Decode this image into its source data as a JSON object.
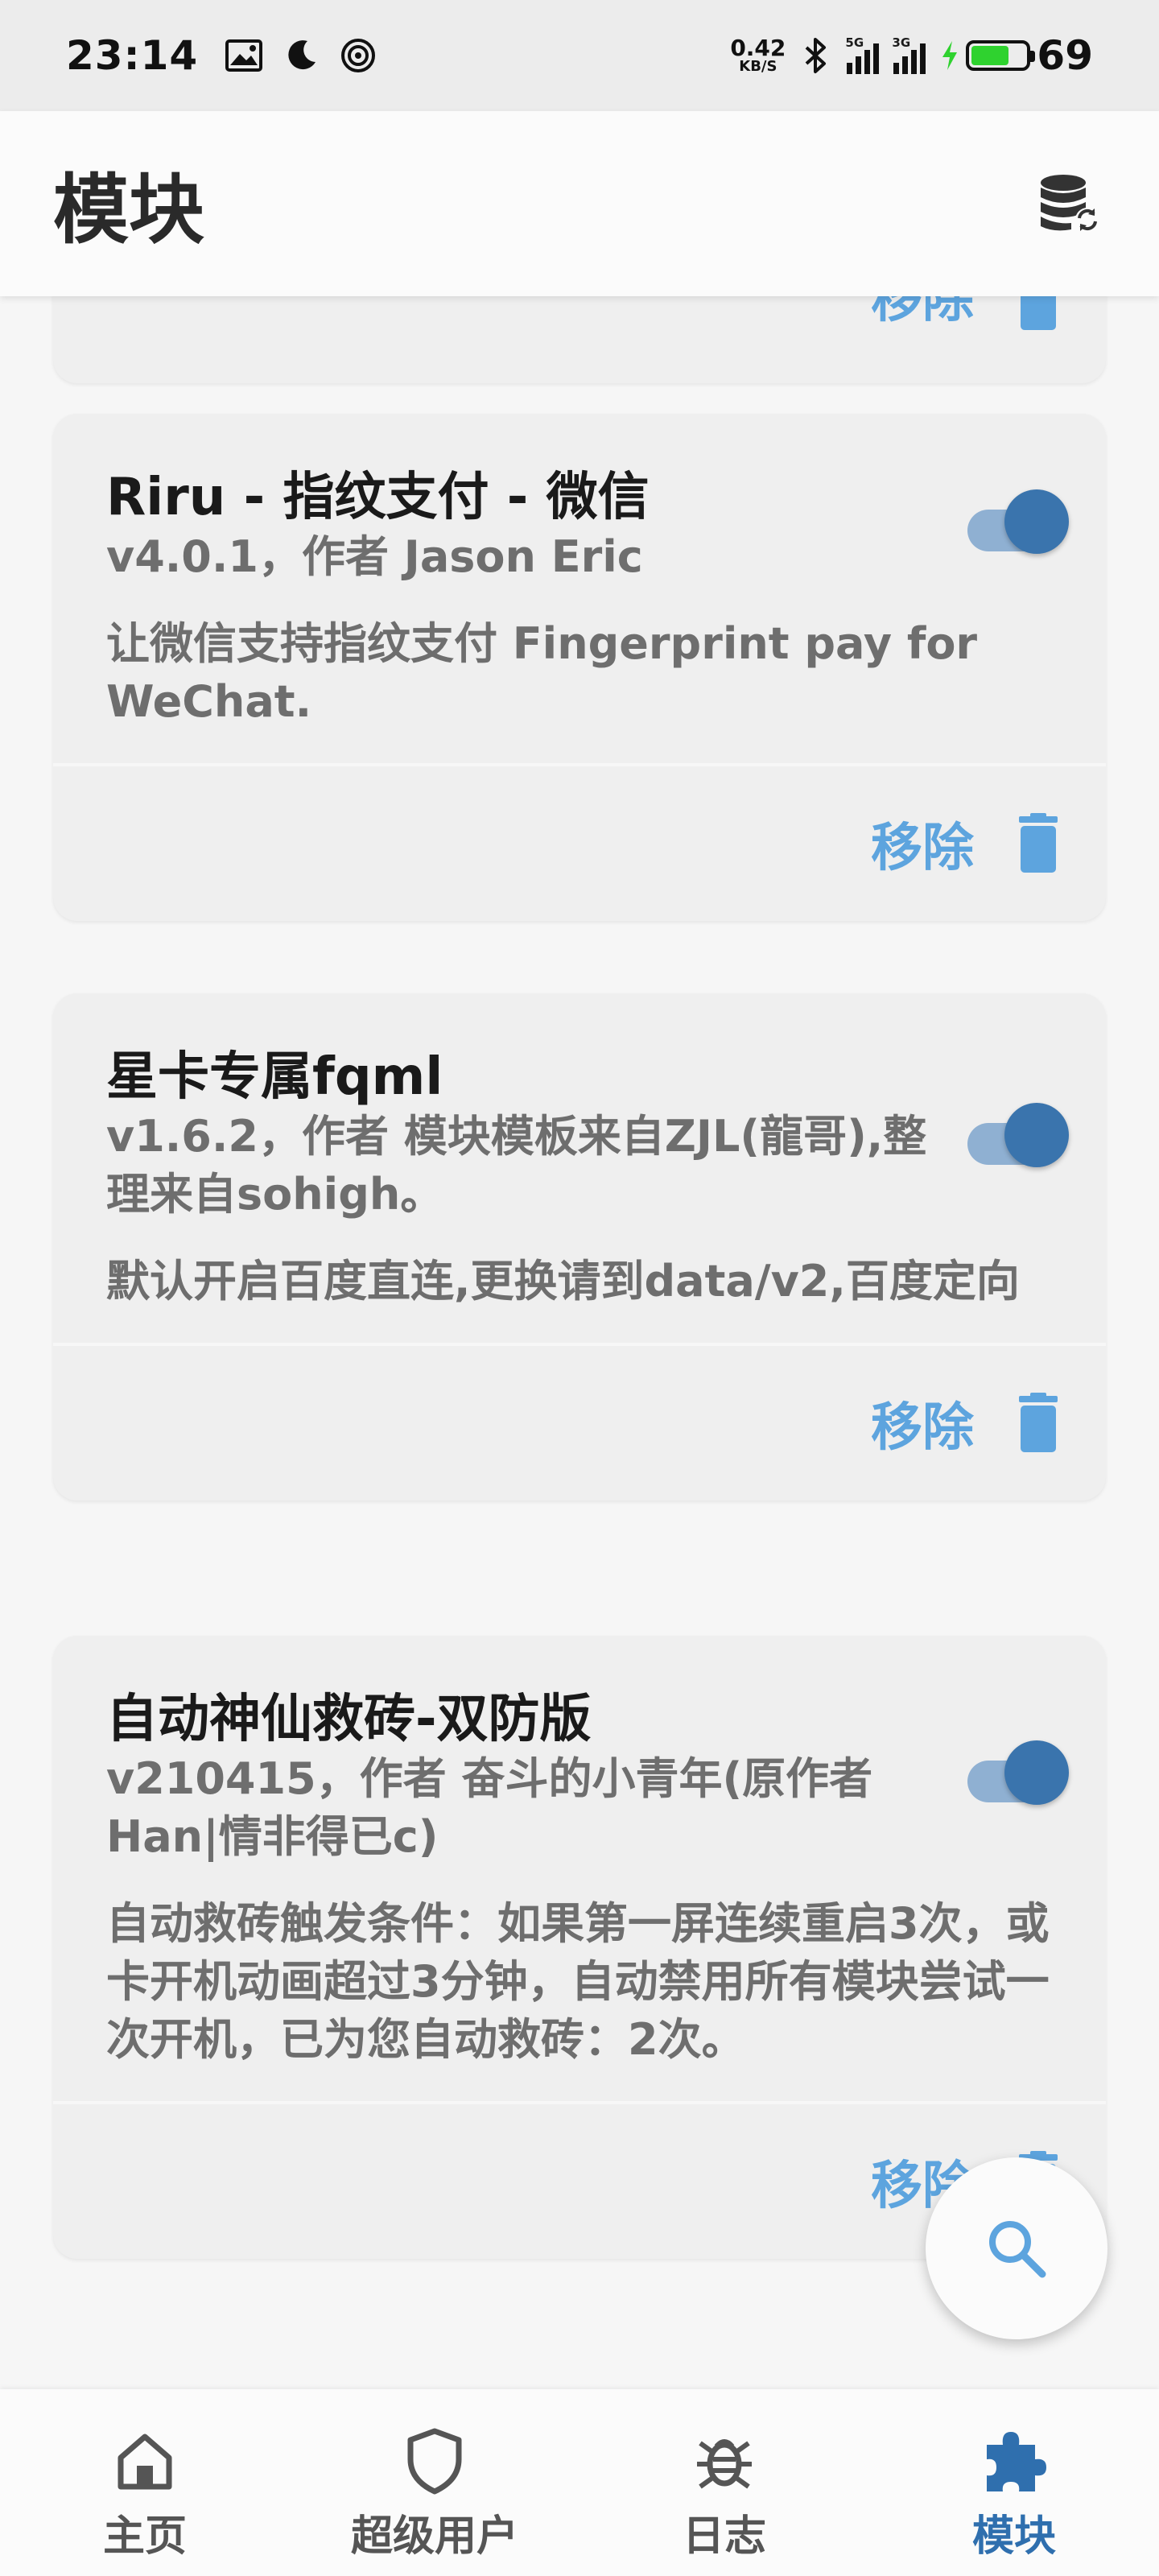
{
  "status_bar": {
    "time": "23:14",
    "net_speed_value": "0.42",
    "net_speed_unit": "KB/S",
    "sim1_label": "5G",
    "sim2_label": "3G",
    "battery": "69"
  },
  "app_bar": {
    "title": "模块"
  },
  "cards": [
    {
      "title": "Riru - 指纹支付 - 微信",
      "meta": "v4.0.1，作者 Jason Eric",
      "description": "让微信支持指纹支付 Fingerprint pay for WeChat.",
      "enabled": true,
      "remove_label": "移除"
    },
    {
      "title": "星卡专属fqml",
      "meta": "v1.6.2，作者 模块模板来自ZJL(龍哥),整理来自sohigh。",
      "description": "默认开启百度直连,更换请到data/v2,百度定向",
      "enabled": true,
      "remove_label": "移除"
    },
    {
      "title": "自动神仙救砖-双防版",
      "meta": "v210415，作者 奋斗的小青年(原作者Han|情非得已c)",
      "description": "自动救砖触发条件：如果第一屏连续重启3次，或卡开机动画超过3分钟，自动禁用所有模块尝试一次开机，已为您自动救砖：2次。",
      "enabled": true,
      "remove_label": "移除"
    }
  ],
  "partial_card": {
    "remove_label": "移除"
  },
  "bottom_nav": {
    "items": [
      {
        "label": "主页",
        "icon": "home-icon"
      },
      {
        "label": "超级用户",
        "icon": "shield-icon"
      },
      {
        "label": "日志",
        "icon": "bug-icon"
      },
      {
        "label": "模块",
        "icon": "puzzle-icon"
      }
    ],
    "active_index": 3
  },
  "colors": {
    "accent": "#2f6fae",
    "remove": "#5da4de",
    "toggle_knob": "#3a74ad",
    "toggle_track": "#8fb0d2"
  }
}
